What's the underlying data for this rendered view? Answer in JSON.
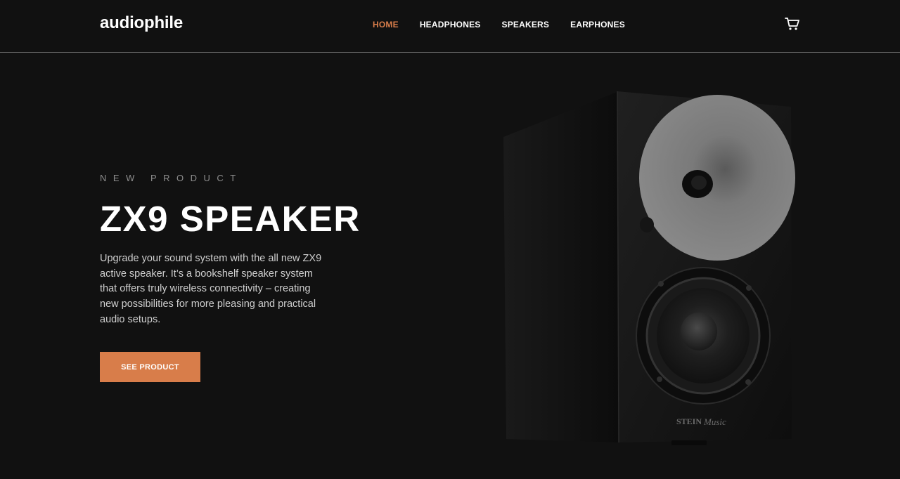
{
  "header": {
    "logo": "audiophile",
    "nav": [
      {
        "label": "HOME",
        "active": true
      },
      {
        "label": "HEADPHONES",
        "active": false
      },
      {
        "label": "SPEAKERS",
        "active": false
      },
      {
        "label": "EARPHONES",
        "active": false
      }
    ],
    "cart_icon": "cart-icon"
  },
  "hero": {
    "overline": "NEW PRODUCT",
    "title": "ZX9 SPEAKER",
    "description": "Upgrade your sound system with the all new ZX9 active speaker. It’s a bookshelf speaker system that offers truly wireless connectivity – creating new possibilities for more pleasing and practical audio setups.",
    "cta_label": "SEE PRODUCT",
    "product_brand_mark": "STEIN Music"
  },
  "colors": {
    "accent": "#D87D4A",
    "background": "#111111",
    "text": "#FFFFFF"
  }
}
